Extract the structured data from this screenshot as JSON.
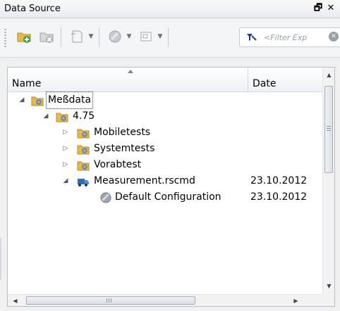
{
  "window": {
    "title": "Data Source",
    "float_glyph": "🗗",
    "close_glyph": "✕"
  },
  "toolbar": {
    "buttons": [
      {
        "name": "add-source",
        "icon": "folder-add-icon"
      },
      {
        "name": "remove-source",
        "icon": "folder-remove-icon"
      },
      {
        "name": "script",
        "icon": "document-icon"
      },
      {
        "name": "config",
        "icon": "disc-icon"
      },
      {
        "name": "view",
        "icon": "window-icon"
      }
    ],
    "filter_placeholder": "<Filter Exp"
  },
  "table": {
    "columns": [
      "Name",
      "Date"
    ],
    "rows": [
      {
        "label": "Meßdata",
        "date": "",
        "expanded": true,
        "indent": 0,
        "icon": "folder-gear-icon",
        "selected": true
      },
      {
        "label": "4.75",
        "date": "",
        "expanded": true,
        "indent": 1,
        "icon": "folder-gear-icon"
      },
      {
        "label": "Mobiletests",
        "date": "",
        "expanded": false,
        "indent": 2,
        "icon": "folder-gear-icon"
      },
      {
        "label": "Systemtests",
        "date": "",
        "expanded": false,
        "indent": 2,
        "icon": "folder-gear-icon"
      },
      {
        "label": "Vorabtest",
        "date": "",
        "expanded": false,
        "indent": 2,
        "icon": "folder-gear-icon"
      },
      {
        "label": "Measurement.rscmd",
        "date": "23.10.2012",
        "expanded": true,
        "indent": 2,
        "icon": "truck-icon"
      },
      {
        "label": "Default Configuration",
        "date": "23.10.2012",
        "expanded": null,
        "indent": 3,
        "icon": "disc-icon"
      }
    ]
  },
  "colors": {
    "folder": "#e8b84a",
    "gear": "#6b8bb8",
    "truck": "#2f6fb5"
  }
}
